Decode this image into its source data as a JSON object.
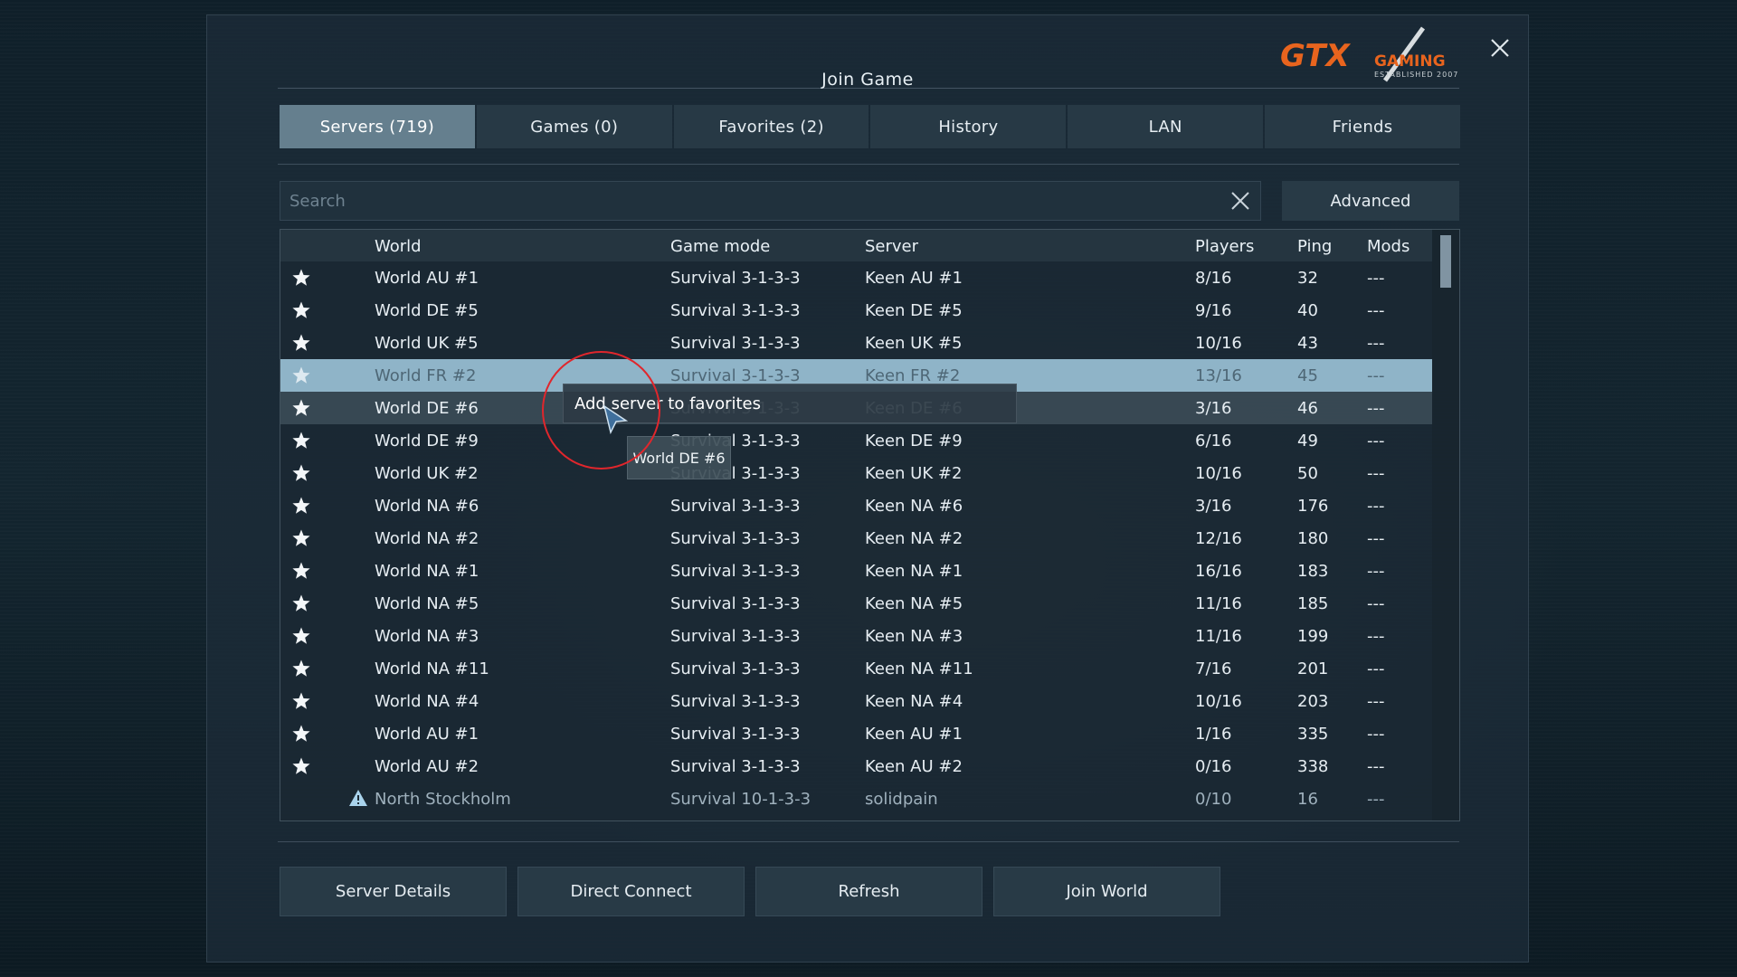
{
  "dialog": {
    "title": "Join Game"
  },
  "logo": {
    "brand": "GTX",
    "sub": "GAMING",
    "tagline": "ESTABLISHED 2007"
  },
  "tabs": [
    {
      "label": "Servers (719)",
      "active": true
    },
    {
      "label": "Games (0)",
      "active": false
    },
    {
      "label": "Favorites (2)",
      "active": false
    },
    {
      "label": "History",
      "active": false
    },
    {
      "label": "LAN",
      "active": false
    },
    {
      "label": "Friends",
      "active": false
    }
  ],
  "search": {
    "placeholder": "Search",
    "value": ""
  },
  "advanced_label": "Advanced",
  "columns": {
    "world": "World",
    "mode": "Game mode",
    "server": "Server",
    "players": "Players",
    "ping": "Ping",
    "mods": "Mods"
  },
  "rows": [
    {
      "world": "World AU #1",
      "mode": "Survival 3-1-3-3",
      "server": "Keen AU #1",
      "players": "8/16",
      "ping": "32",
      "mods": "---"
    },
    {
      "world": "World DE #5",
      "mode": "Survival 3-1-3-3",
      "server": "Keen DE #5",
      "players": "9/16",
      "ping": "40",
      "mods": "---"
    },
    {
      "world": "World UK #5",
      "mode": "Survival 3-1-3-3",
      "server": "Keen UK #5",
      "players": "10/16",
      "ping": "43",
      "mods": "---"
    },
    {
      "world": "World FR #2",
      "mode": "Survival 3-1-3-3",
      "server": "Keen FR #2",
      "players": "13/16",
      "ping": "45",
      "mods": "---"
    },
    {
      "world": "World DE #6",
      "mode": "Survival 3-1-3-3",
      "server": "Keen DE #6",
      "players": "3/16",
      "ping": "46",
      "mods": "---"
    },
    {
      "world": "World DE #9",
      "mode": "Survival 3-1-3-3",
      "server": "Keen DE #9",
      "players": "6/16",
      "ping": "49",
      "mods": "---"
    },
    {
      "world": "World UK #2",
      "mode": "Survival 3-1-3-3",
      "server": "Keen UK #2",
      "players": "10/16",
      "ping": "50",
      "mods": "---"
    },
    {
      "world": "World NA #6",
      "mode": "Survival 3-1-3-3",
      "server": "Keen NA #6",
      "players": "3/16",
      "ping": "176",
      "mods": "---"
    },
    {
      "world": "World NA #2",
      "mode": "Survival 3-1-3-3",
      "server": "Keen NA #2",
      "players": "12/16",
      "ping": "180",
      "mods": "---"
    },
    {
      "world": "World NA #1",
      "mode": "Survival 3-1-3-3",
      "server": "Keen NA #1",
      "players": "16/16",
      "ping": "183",
      "mods": "---"
    },
    {
      "world": "World NA #5",
      "mode": "Survival 3-1-3-3",
      "server": "Keen NA #5",
      "players": "11/16",
      "ping": "185",
      "mods": "---"
    },
    {
      "world": "World NA #3",
      "mode": "Survival 3-1-3-3",
      "server": "Keen NA #3",
      "players": "11/16",
      "ping": "199",
      "mods": "---"
    },
    {
      "world": "World NA #11",
      "mode": "Survival 3-1-3-3",
      "server": "Keen NA #11",
      "players": "7/16",
      "ping": "201",
      "mods": "---"
    },
    {
      "world": "World NA #4",
      "mode": "Survival 3-1-3-3",
      "server": "Keen NA #4",
      "players": "10/16",
      "ping": "203",
      "mods": "---"
    },
    {
      "world": "World AU #1",
      "mode": "Survival 3-1-3-3",
      "server": "Keen AU #1",
      "players": "1/16",
      "ping": "335",
      "mods": "---"
    },
    {
      "world": "World AU #2",
      "mode": "Survival 3-1-3-3",
      "server": "Keen AU #2",
      "players": "0/16",
      "ping": "338",
      "mods": "---"
    },
    {
      "world": "North Stockholm",
      "mode": "Survival 10-1-3-3",
      "server": "solidpain",
      "players": "0/10",
      "ping": "16",
      "mods": "---"
    }
  ],
  "tooltip": {
    "text": "Add server to favorites",
    "row_label": "World DE #6"
  },
  "buttons": {
    "details": "Server Details",
    "direct": "Direct Connect",
    "refresh": "Refresh",
    "join": "Join World"
  },
  "colors": {
    "selected_row": "#8fb4c8",
    "active_tab": "#69849a",
    "annotation_circle": "#e0262c",
    "logo_orange": "#e8641e"
  },
  "icons": {
    "star": "star-icon",
    "warning": "warning-icon",
    "close": "close-icon",
    "clear": "clear-search-icon"
  }
}
